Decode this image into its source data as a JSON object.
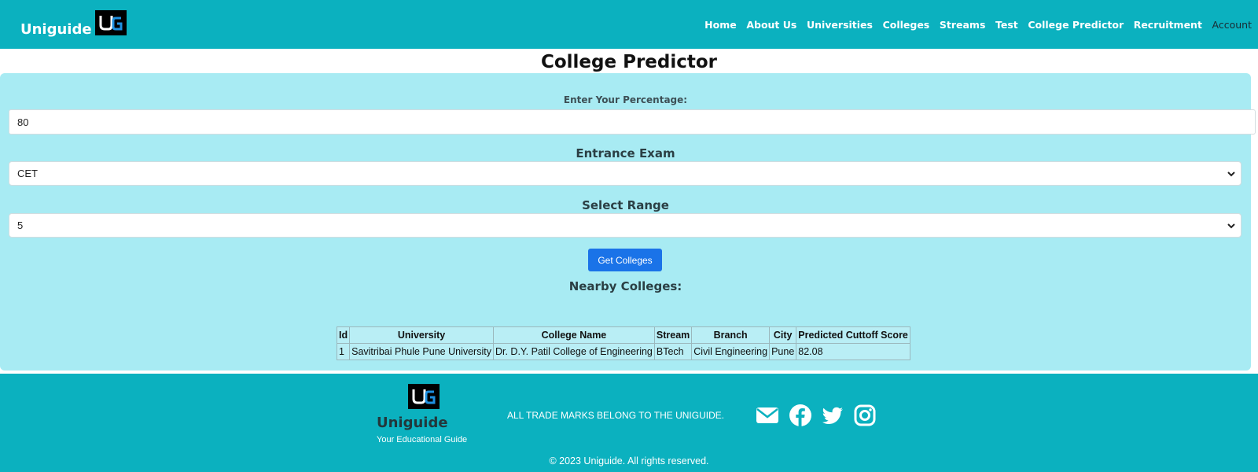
{
  "header": {
    "brand": "Uniguide",
    "logo_text": "UG",
    "nav": [
      "Home",
      "About Us",
      "Universities",
      "Colleges",
      "Streams",
      "Test",
      "College Predictor",
      "Recruitment"
    ],
    "account_label": "Account"
  },
  "page": {
    "title": "College Predictor"
  },
  "form": {
    "percentage_label": "Enter Your Percentage:",
    "percentage_value": "80",
    "exam_label": "Entrance Exam",
    "exam_value": "CET",
    "range_label": "Select Range",
    "range_value": "5",
    "submit_label": "Get Colleges",
    "results_heading": "Nearby Colleges:"
  },
  "results": {
    "columns": [
      "Id",
      "University",
      "College Name",
      "Stream",
      "Branch",
      "City",
      "Predicted Cuttoff Score"
    ],
    "rows": [
      [
        "1",
        "Savitribai Phule Pune University",
        "Dr. D.Y. Patil College of Engineering",
        "BTech",
        "Civil Engineering",
        "Pune",
        "82.08"
      ]
    ]
  },
  "footer": {
    "brand": "Uniguide",
    "tagline": "Your Educational Guide",
    "trademark": "ALL TRADE MARKS BELONG TO THE UNIGUIDE.",
    "social_icons": [
      "envelope-icon",
      "facebook-icon",
      "twitter-icon",
      "instagram-icon"
    ],
    "copyright": "© 2023 Uniguide. All rights reserved."
  },
  "colors": {
    "header_bg": "#0bb1bf",
    "panel_bg": "#a8ebf3",
    "button_bg": "#1a73e8"
  }
}
